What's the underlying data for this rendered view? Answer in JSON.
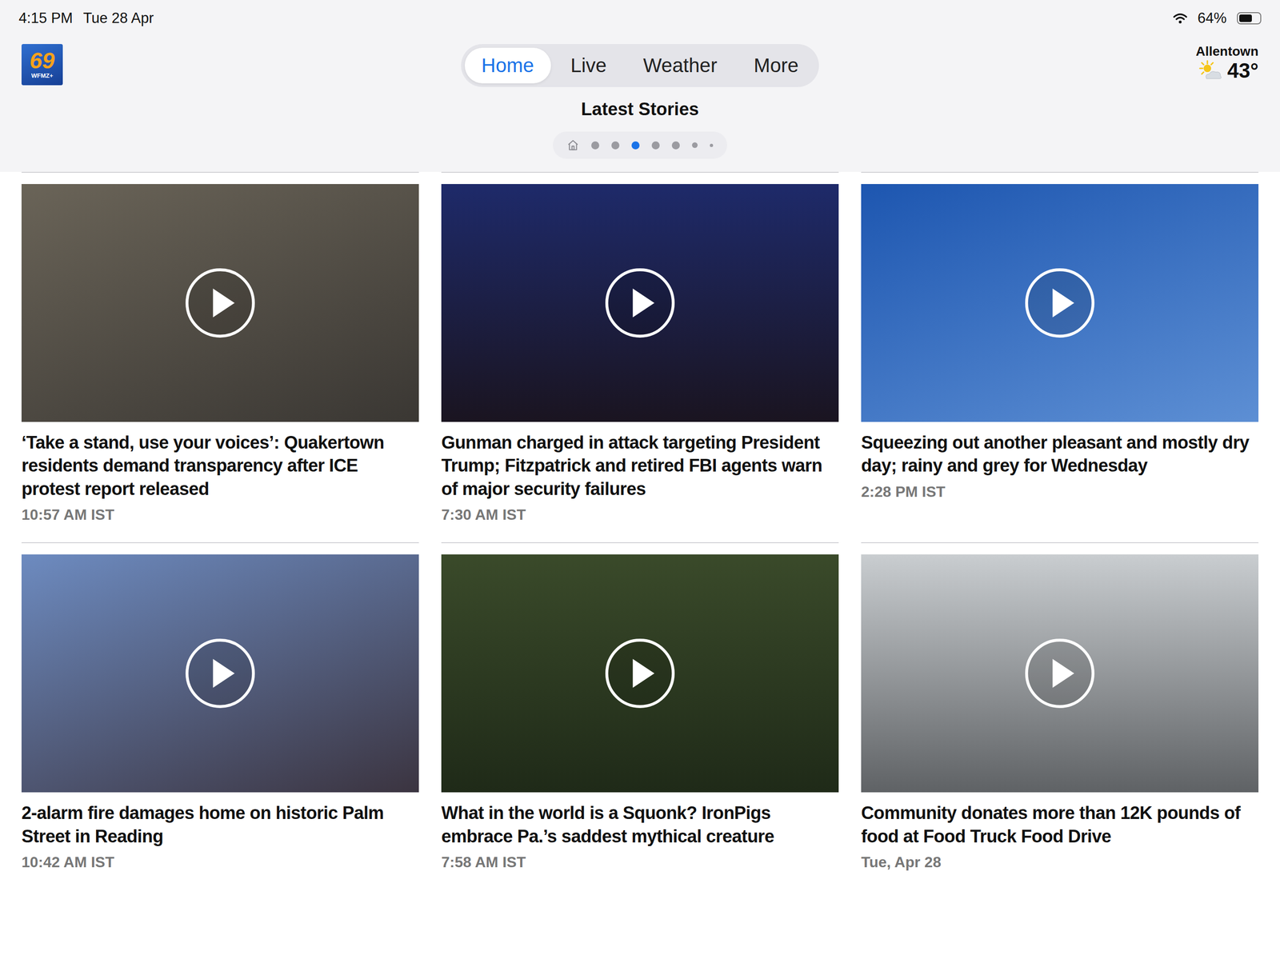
{
  "status_bar": {
    "time": "4:15 PM",
    "date": "Tue 28 Apr",
    "battery": "64%",
    "battery_level": 0.64
  },
  "logo": {
    "number": "69",
    "brand": "WFMZ+"
  },
  "tabs": [
    {
      "label": "Home",
      "selected": true
    },
    {
      "label": "Live",
      "selected": false
    },
    {
      "label": "Weather",
      "selected": false
    },
    {
      "label": "More",
      "selected": false
    }
  ],
  "weather": {
    "city": "Allentown",
    "temperature": "43°"
  },
  "section": {
    "title": "Latest Stories"
  },
  "pager": {
    "dots": [
      {
        "kind": "full",
        "selected": false
      },
      {
        "kind": "full",
        "selected": false
      },
      {
        "kind": "full",
        "selected": true
      },
      {
        "kind": "full",
        "selected": false
      },
      {
        "kind": "full",
        "selected": false
      },
      {
        "kind": "small",
        "selected": false
      },
      {
        "kind": "tiny",
        "selected": false
      }
    ]
  },
  "stories": [
    {
      "title": "‘Take a stand, use your voices’: Quakertown residents demand transparency after ICE protest report released",
      "time": "10:57 AM IST"
    },
    {
      "title": "Gunman charged in attack targeting President Trump; Fitzpatrick and retired FBI agents warn of major security failures",
      "time": "7:30 AM IST"
    },
    {
      "title": "Squeezing out another pleasant and mostly dry day; rainy and grey for Wednesday",
      "time": "2:28 PM IST"
    },
    {
      "title": "2-alarm fire damages home on historic Palm Street in Reading",
      "time": "10:42 AM IST"
    },
    {
      "title": "What in the world is a Squonk? IronPigs embrace Pa.’s saddest mythical creature",
      "time": "7:58 AM IST"
    },
    {
      "title": "Community donates more than 12K pounds of food at Food Truck Food Drive",
      "time": "Tue, Apr 28"
    }
  ]
}
